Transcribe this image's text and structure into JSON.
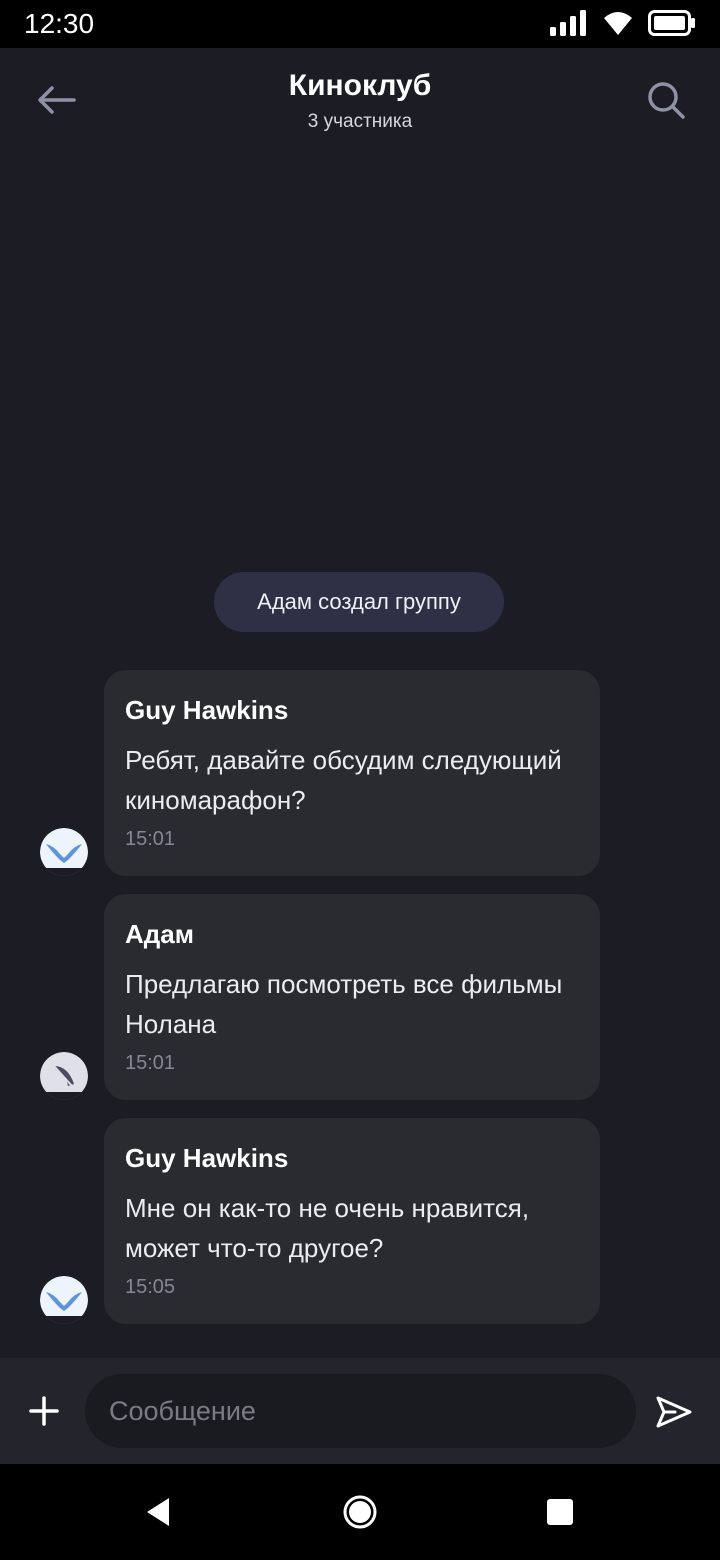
{
  "status_bar": {
    "time": "12:30"
  },
  "header": {
    "title": "Киноклуб",
    "subtitle": "3 участника"
  },
  "system_message": "Адам создал группу",
  "messages": [
    {
      "sender": "Guy Hawkins",
      "text": "Ребят, давайте обсудим следующий киномарафон?",
      "time": "15:01",
      "avatar": "bird-avatar-icon"
    },
    {
      "sender": "Адам",
      "text": "Предлагаю посмотреть все фильмы Нолана",
      "time": "15:01",
      "avatar": "feather-avatar-icon"
    },
    {
      "sender": "Guy Hawkins",
      "text": "Мне он как-то не очень нравится, может что-то другое?",
      "time": "15:05",
      "avatar": "bird-avatar-icon"
    }
  ],
  "composer": {
    "placeholder": "Сообщение"
  },
  "colors": {
    "background": "#1c1d24",
    "bubble": "#2a2b31",
    "system_pill": "#2e3046",
    "icon_muted": "#6b6d86"
  }
}
